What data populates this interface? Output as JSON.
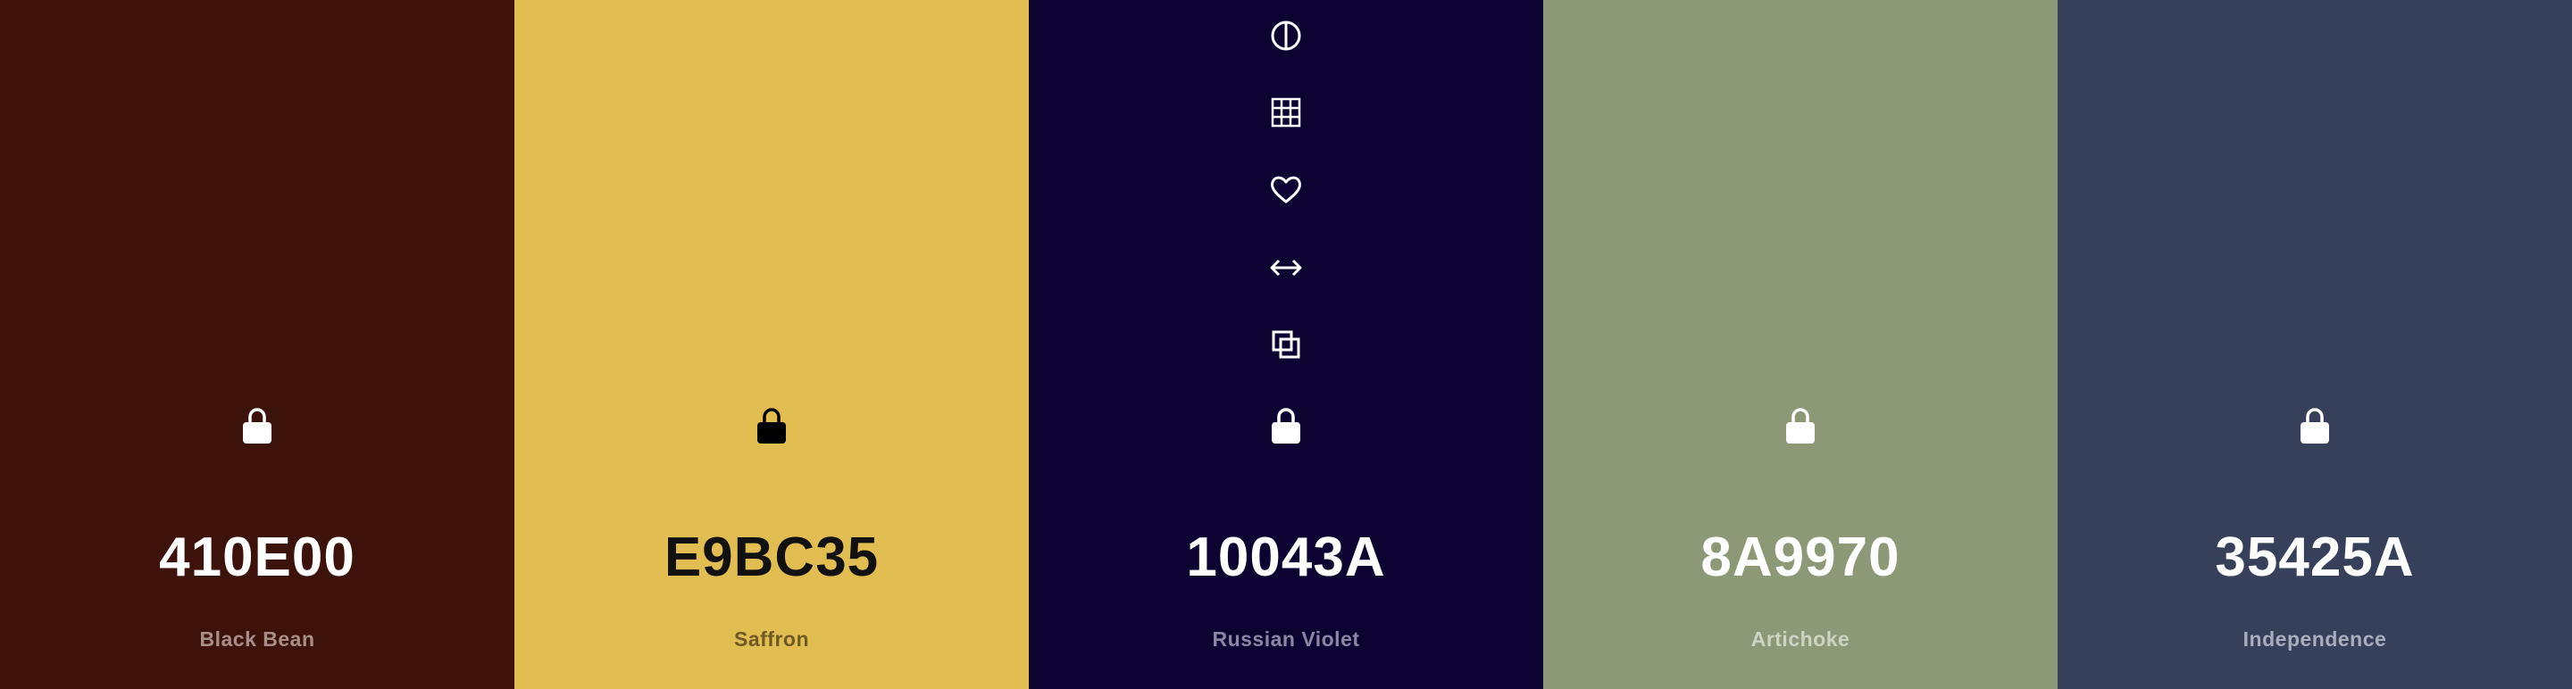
{
  "palette": {
    "colors": [
      {
        "hex": "410E00",
        "name": "Black Bean",
        "swatch": "#3C120A",
        "text_tone": "light",
        "locked": true
      },
      {
        "hex": "E9BC35",
        "name": "Saffron",
        "swatch": "#E2BD52",
        "text_tone": "dark",
        "locked": true
      },
      {
        "hex": "10043A",
        "name": "Russian Violet",
        "swatch": "#0D0333",
        "text_tone": "light",
        "locked": true
      },
      {
        "hex": "8A9970",
        "name": "Artichoke",
        "swatch": "#8D9976",
        "text_tone": "light",
        "locked": true
      },
      {
        "hex": "35425A",
        "name": "Independence",
        "swatch": "#37405A",
        "text_tone": "light",
        "locked": true
      }
    ],
    "hover_tools": {
      "column": 3,
      "icons": [
        "contrast-icon",
        "shades-grid-icon",
        "heart-icon",
        "drag-arrows-icon",
        "copy-icon",
        "lock-icon"
      ]
    }
  }
}
